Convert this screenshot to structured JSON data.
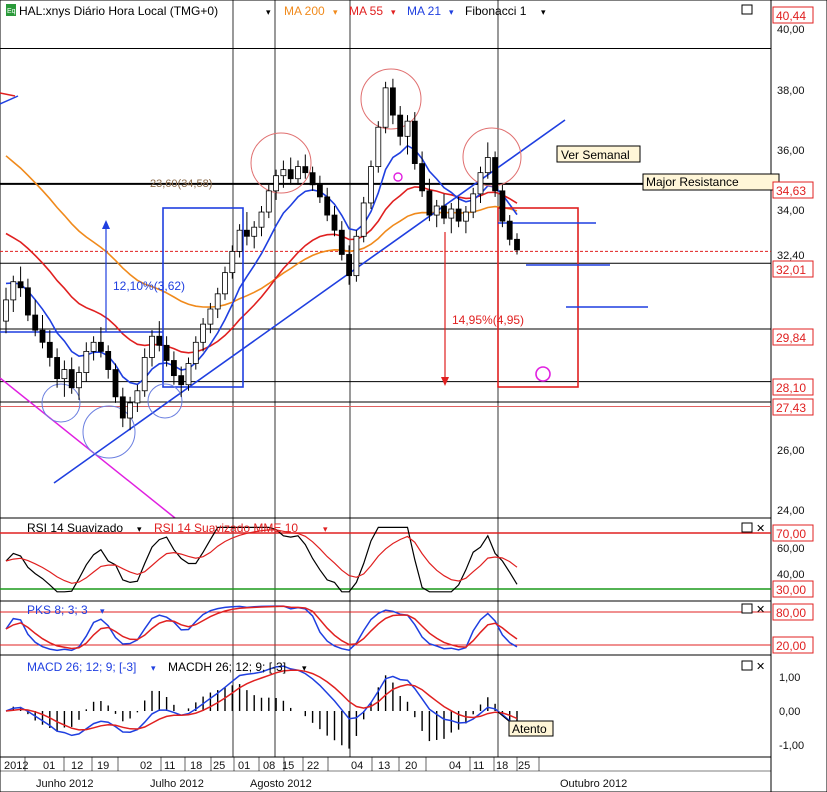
{
  "colors": {
    "up": "#ffffff",
    "down": "#000000",
    "ma200": "#f08a1c",
    "ma55": "#e02020",
    "ma21": "#1f3fe0",
    "trend_magenta": "#e020e0",
    "rsi_black": "#000000",
    "rsi_red": "#e02020",
    "stoch_blue": "#1f3fe0",
    "stoch_red": "#e02020"
  },
  "legend": {
    "icon": "Eq",
    "symbol": "HAL:xnys Diário Hora Local (TMG+0)",
    "ma200": "MA 200",
    "ma55": "MA 55",
    "ma21": "MA 21",
    "fib": "Fibonacci 1"
  },
  "annotations": {
    "ver_semanal": "Ver Semanal",
    "major_resistance": "Major Resistance",
    "fib_level": "23,60(34,58)",
    "gain": "12,10%(3,62)",
    "loss": "14,95%(4,95)",
    "atento": "Atento"
  },
  "price_tags": [
    "40,44",
    "34,63",
    "32,01",
    "29,84",
    "28,10",
    "27,43"
  ],
  "price_ticks": [
    "40,00",
    "38,00",
    "36,00",
    "34,00",
    "32,40",
    "26,00",
    "24,00"
  ],
  "rsi": {
    "title1": "RSI 14 Suavizado",
    "title2": "RSI 14 Suavizado MME 10",
    "tags": [
      "70,00",
      "30,00"
    ],
    "ticks": [
      "60,00",
      "40,00"
    ]
  },
  "stoch": {
    "title": "PKS 8; 3; 3",
    "tags": [
      "80,00",
      "20,00"
    ]
  },
  "macd": {
    "title1": "MACD 26; 12; 9; [-3]",
    "title2": "MACDH 26; 12; 9; [-3]",
    "ticks": [
      "1,00",
      "0,00",
      "-1,00"
    ]
  },
  "x_days": [
    "2012",
    "01",
    "12",
    "19",
    "02",
    "11",
    "18",
    "25",
    "01",
    "08",
    "15",
    "22",
    "04",
    "13",
    "20",
    "04",
    "11",
    "18",
    "25"
  ],
  "x_months": [
    "Junho 2012",
    "Julho 2012",
    "Agosto 2012",
    "Outubro 2012"
  ],
  "chart_data": {
    "type": "candlestick",
    "title": "HAL:xnys Diário Hora Local (TMG+0)",
    "ylim": [
      23.6,
      40.7
    ],
    "price_levels": [
      34.63,
      32.01,
      29.84,
      28.1,
      27.43,
      32.4
    ],
    "candles": [
      {
        "o": 30.1,
        "h": 31.2,
        "l": 29.7,
        "c": 30.8
      },
      {
        "o": 30.8,
        "h": 31.6,
        "l": 30.4,
        "c": 31.4
      },
      {
        "o": 31.4,
        "h": 31.9,
        "l": 30.9,
        "c": 31.2
      },
      {
        "o": 31.2,
        "h": 31.5,
        "l": 30.1,
        "c": 30.3
      },
      {
        "o": 30.3,
        "h": 30.8,
        "l": 29.6,
        "c": 29.8
      },
      {
        "o": 29.8,
        "h": 30.3,
        "l": 29.2,
        "c": 29.4
      },
      {
        "o": 29.4,
        "h": 29.8,
        "l": 28.6,
        "c": 28.9
      },
      {
        "o": 28.9,
        "h": 29.2,
        "l": 27.9,
        "c": 28.2
      },
      {
        "o": 28.2,
        "h": 28.8,
        "l": 27.6,
        "c": 28.5
      },
      {
        "o": 28.5,
        "h": 28.9,
        "l": 27.7,
        "c": 27.9
      },
      {
        "o": 27.9,
        "h": 28.6,
        "l": 27.5,
        "c": 28.4
      },
      {
        "o": 28.4,
        "h": 29.4,
        "l": 28.1,
        "c": 29.1
      },
      {
        "o": 29.1,
        "h": 29.6,
        "l": 28.8,
        "c": 29.4
      },
      {
        "o": 29.4,
        "h": 29.9,
        "l": 28.9,
        "c": 29.1
      },
      {
        "o": 29.1,
        "h": 29.3,
        "l": 28.2,
        "c": 28.5
      },
      {
        "o": 28.5,
        "h": 28.7,
        "l": 27.4,
        "c": 27.6
      },
      {
        "o": 27.6,
        "h": 27.9,
        "l": 26.6,
        "c": 26.9
      },
      {
        "o": 26.9,
        "h": 27.6,
        "l": 26.5,
        "c": 27.4
      },
      {
        "o": 27.4,
        "h": 28.0,
        "l": 27.1,
        "c": 27.8
      },
      {
        "o": 27.8,
        "h": 29.2,
        "l": 27.6,
        "c": 28.9
      },
      {
        "o": 28.9,
        "h": 29.8,
        "l": 28.6,
        "c": 29.6
      },
      {
        "o": 29.6,
        "h": 30.1,
        "l": 29.1,
        "c": 29.3
      },
      {
        "o": 29.3,
        "h": 29.6,
        "l": 28.6,
        "c": 28.8
      },
      {
        "o": 28.8,
        "h": 29.1,
        "l": 28.0,
        "c": 28.3
      },
      {
        "o": 28.3,
        "h": 28.6,
        "l": 27.6,
        "c": 28.0
      },
      {
        "o": 28.0,
        "h": 28.9,
        "l": 27.8,
        "c": 28.7
      },
      {
        "o": 28.7,
        "h": 29.6,
        "l": 28.5,
        "c": 29.4
      },
      {
        "o": 29.4,
        "h": 30.2,
        "l": 29.1,
        "c": 30.0
      },
      {
        "o": 30.0,
        "h": 30.7,
        "l": 29.7,
        "c": 30.5
      },
      {
        "o": 30.5,
        "h": 31.2,
        "l": 30.2,
        "c": 31.0
      },
      {
        "o": 31.0,
        "h": 31.9,
        "l": 30.8,
        "c": 31.7
      },
      {
        "o": 31.7,
        "h": 32.6,
        "l": 31.5,
        "c": 32.4
      },
      {
        "o": 32.4,
        "h": 33.3,
        "l": 32.2,
        "c": 33.1
      },
      {
        "o": 33.1,
        "h": 33.7,
        "l": 32.6,
        "c": 32.9
      },
      {
        "o": 32.9,
        "h": 33.4,
        "l": 32.5,
        "c": 33.2
      },
      {
        "o": 33.2,
        "h": 33.9,
        "l": 32.9,
        "c": 33.7
      },
      {
        "o": 33.7,
        "h": 34.6,
        "l": 33.5,
        "c": 34.4
      },
      {
        "o": 34.4,
        "h": 35.1,
        "l": 34.1,
        "c": 34.9
      },
      {
        "o": 34.9,
        "h": 35.4,
        "l": 34.5,
        "c": 35.1
      },
      {
        "o": 35.1,
        "h": 35.5,
        "l": 34.6,
        "c": 34.8
      },
      {
        "o": 34.8,
        "h": 35.4,
        "l": 34.6,
        "c": 35.2
      },
      {
        "o": 35.2,
        "h": 35.6,
        "l": 34.8,
        "c": 35.0
      },
      {
        "o": 35.0,
        "h": 35.2,
        "l": 34.4,
        "c": 34.6
      },
      {
        "o": 34.6,
        "h": 34.9,
        "l": 34.0,
        "c": 34.2
      },
      {
        "o": 34.2,
        "h": 34.5,
        "l": 33.4,
        "c": 33.6
      },
      {
        "o": 33.6,
        "h": 33.9,
        "l": 32.9,
        "c": 33.1
      },
      {
        "o": 33.1,
        "h": 33.4,
        "l": 32.1,
        "c": 32.3
      },
      {
        "o": 32.3,
        "h": 32.6,
        "l": 31.3,
        "c": 31.6
      },
      {
        "o": 31.6,
        "h": 33.1,
        "l": 31.4,
        "c": 32.9
      },
      {
        "o": 32.9,
        "h": 34.2,
        "l": 32.7,
        "c": 34.0
      },
      {
        "o": 34.0,
        "h": 35.4,
        "l": 33.8,
        "c": 35.2
      },
      {
        "o": 35.2,
        "h": 36.7,
        "l": 35.0,
        "c": 36.5
      },
      {
        "o": 36.5,
        "h": 38.0,
        "l": 36.3,
        "c": 37.8
      },
      {
        "o": 37.8,
        "h": 38.1,
        "l": 36.6,
        "c": 36.9
      },
      {
        "o": 36.9,
        "h": 37.2,
        "l": 35.9,
        "c": 36.2
      },
      {
        "o": 36.2,
        "h": 36.9,
        "l": 35.6,
        "c": 36.7
      },
      {
        "o": 36.7,
        "h": 37.0,
        "l": 35.1,
        "c": 35.3
      },
      {
        "o": 35.3,
        "h": 35.7,
        "l": 34.2,
        "c": 34.4
      },
      {
        "o": 34.4,
        "h": 34.8,
        "l": 33.4,
        "c": 33.6
      },
      {
        "o": 33.6,
        "h": 34.1,
        "l": 33.2,
        "c": 33.9
      },
      {
        "o": 33.9,
        "h": 34.3,
        "l": 33.3,
        "c": 33.5
      },
      {
        "o": 33.5,
        "h": 34.0,
        "l": 33.0,
        "c": 33.8
      },
      {
        "o": 33.8,
        "h": 34.2,
        "l": 33.2,
        "c": 33.4
      },
      {
        "o": 33.4,
        "h": 33.9,
        "l": 33.0,
        "c": 33.7
      },
      {
        "o": 33.7,
        "h": 34.5,
        "l": 33.5,
        "c": 34.3
      },
      {
        "o": 34.3,
        "h": 35.2,
        "l": 34.0,
        "c": 35.0
      },
      {
        "o": 35.0,
        "h": 36.0,
        "l": 34.8,
        "c": 35.5
      },
      {
        "o": 35.5,
        "h": 35.7,
        "l": 34.2,
        "c": 34.4
      },
      {
        "o": 34.4,
        "h": 34.6,
        "l": 33.2,
        "c": 33.4
      },
      {
        "o": 33.4,
        "h": 33.6,
        "l": 32.6,
        "c": 32.8
      },
      {
        "o": 32.8,
        "h": 33.0,
        "l": 32.3,
        "c": 32.45
      }
    ]
  }
}
